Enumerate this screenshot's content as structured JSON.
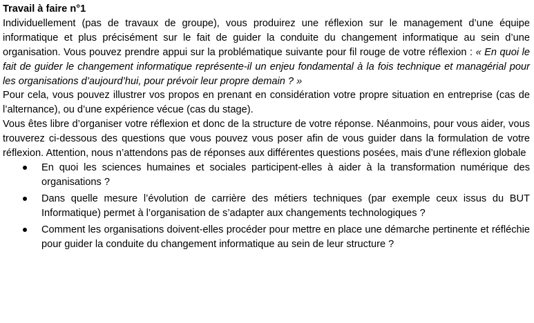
{
  "title": "Travail à faire n°1",
  "intro": {
    "lead": "Individuellement (pas de travaux de groupe), vous produirez une réflexion sur le management d’une équipe informatique et plus précisément sur le fait de guider la conduite du changement informatique au sein d’une organisation. Vous pouvez prendre appui sur la problématique suivante pour fil rouge de votre réflexion : ",
    "question": "« En quoi le fait de guider le changement informatique représente-il un enjeu fondamental à la fois technique et managérial pour les organisations d’aujourd’hui, pour prévoir leur propre demain ? »"
  },
  "paragraph2": "Pour cela, vous pouvez illustrer vos propos en prenant en considération votre propre situation en entreprise (cas de l’alternance), ou d’une expérience vécue (cas du stage).",
  "paragraph3": "Vous êtes libre d’organiser votre réflexion et donc de la structure de votre réponse. Néanmoins, pour vous aider, vous trouverez ci-dessous des questions que vous pouvez vous poser afin de vous guider dans la formulation de votre réflexion. Attention, nous n’attendons pas de réponses aux différentes questions posées, mais d’une réflexion globale",
  "questions": [
    "En quoi les sciences humaines et sociales participent-elles à aider à la transformation numérique des organisations ?",
    "Dans quelle mesure l’évolution de carrière des métiers techniques (par exemple ceux issus du BUT Informatique) permet à l’organisation de s’adapter aux changements technologiques ?",
    "Comment les organisations doivent-elles procéder pour mettre en place une démarche pertinente et réfléchie pour guider la conduite du changement informatique au sein de leur structure ?"
  ]
}
